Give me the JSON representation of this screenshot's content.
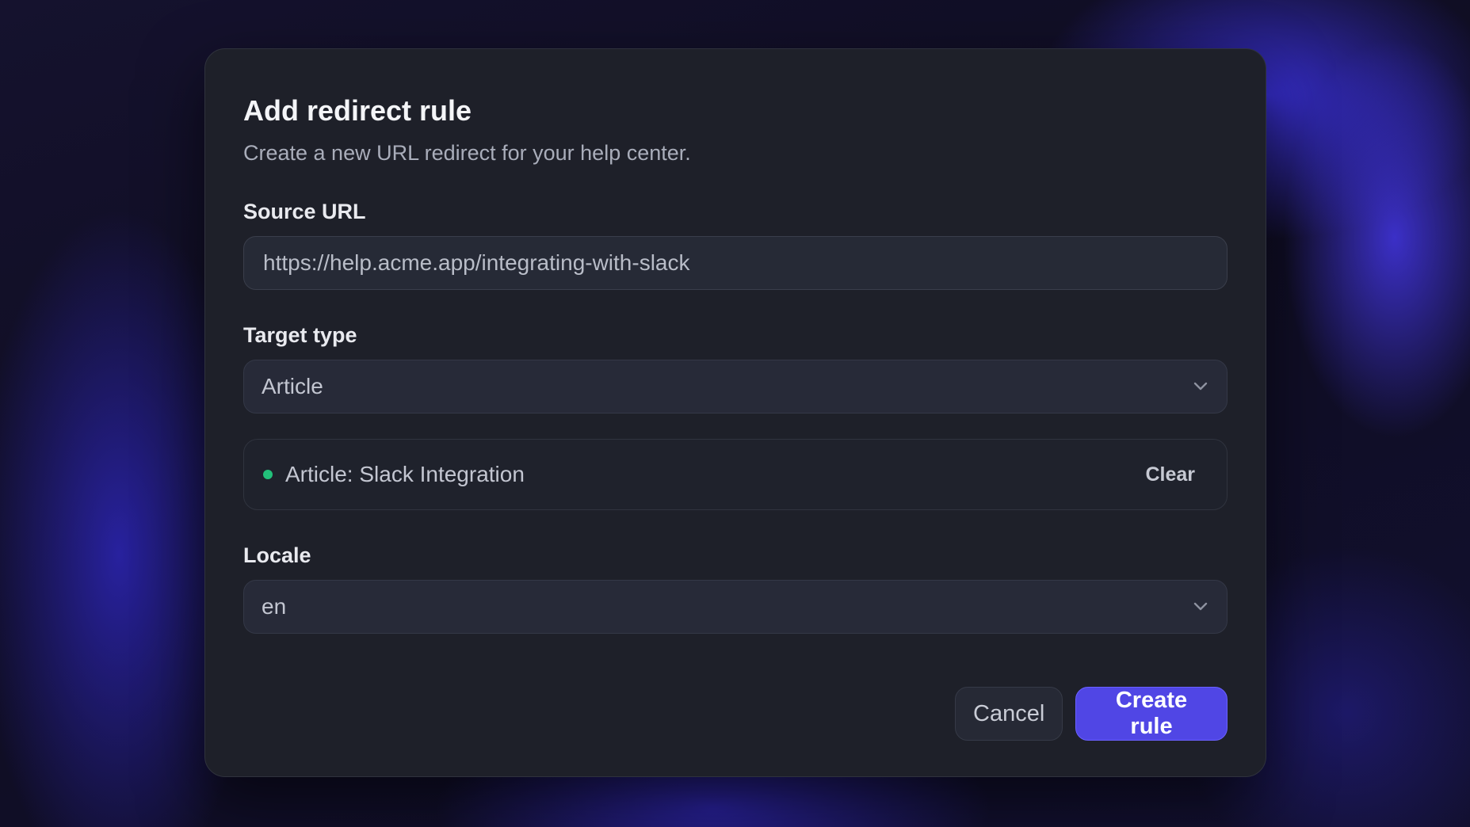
{
  "dialog": {
    "title": "Add redirect rule",
    "subtitle": "Create a new URL redirect for your help center."
  },
  "source_url": {
    "label": "Source URL",
    "value": "https://help.acme.app/integrating-with-slack"
  },
  "target_type": {
    "label": "Target type",
    "selected": "Article",
    "icon": "chevron-down-icon"
  },
  "selected_target": {
    "text": "Article: Slack Integration",
    "status_color": "#22c07a",
    "clear_label": "Clear"
  },
  "locale": {
    "label": "Locale",
    "selected": "en",
    "icon": "chevron-down-icon"
  },
  "actions": {
    "cancel_label": "Cancel",
    "create_label": "Create rule"
  },
  "colors": {
    "accent": "#5046e5",
    "dialog_bg": "#1e2029",
    "success": "#22c07a"
  }
}
